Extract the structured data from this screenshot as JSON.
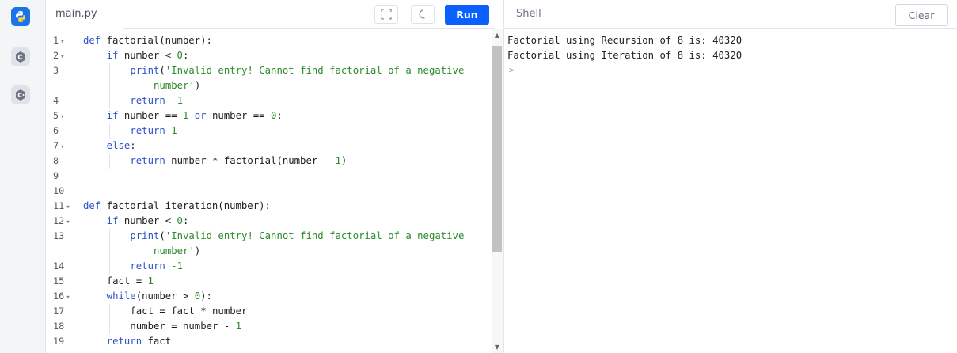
{
  "editor": {
    "tab_label": "main.py",
    "run_label": "Run",
    "lines": [
      {
        "n": "1",
        "fold": "▾",
        "indent": 0,
        "html": "<span class='kw'>def</span> factorial(number):"
      },
      {
        "n": "2",
        "fold": "▾",
        "indent": 1,
        "html": "<span class='kw'>if</span> number &lt; <span class='num'>0</span>:"
      },
      {
        "n": "3",
        "fold": "",
        "indent": 2,
        "html": "<span class='kw'>print</span>(<span class='str'>'Invalid entry! Cannot find factorial of a negative</span>"
      },
      {
        "n": "",
        "fold": "",
        "indent": 3,
        "html": "<span class='str'>number'</span>)"
      },
      {
        "n": "4",
        "fold": "",
        "indent": 2,
        "html": "<span class='kw'>return</span> <span class='num'>-1</span>"
      },
      {
        "n": "5",
        "fold": "▾",
        "indent": 1,
        "html": "<span class='kw'>if</span> number == <span class='num'>1</span> <span class='kw'>or</span> number == <span class='num'>0</span>:"
      },
      {
        "n": "6",
        "fold": "",
        "indent": 2,
        "html": "<span class='kw'>return</span> <span class='num'>1</span>"
      },
      {
        "n": "7",
        "fold": "▾",
        "indent": 1,
        "html": "<span class='kw'>else</span>:"
      },
      {
        "n": "8",
        "fold": "",
        "indent": 2,
        "html": "<span class='kw'>return</span> number * factorial(number - <span class='num'>1</span>)"
      },
      {
        "n": "9",
        "fold": "",
        "indent": 0,
        "html": ""
      },
      {
        "n": "10",
        "fold": "",
        "indent": 0,
        "html": ""
      },
      {
        "n": "11",
        "fold": "▾",
        "indent": 0,
        "html": "<span class='kw'>def</span> factorial_iteration(number):"
      },
      {
        "n": "12",
        "fold": "▾",
        "indent": 1,
        "html": "<span class='kw'>if</span> number &lt; <span class='num'>0</span>:"
      },
      {
        "n": "13",
        "fold": "",
        "indent": 2,
        "html": "<span class='kw'>print</span>(<span class='str'>'Invalid entry! Cannot find factorial of a negative</span>"
      },
      {
        "n": "",
        "fold": "",
        "indent": 3,
        "html": "<span class='str'>number'</span>)"
      },
      {
        "n": "14",
        "fold": "",
        "indent": 2,
        "html": "<span class='kw'>return</span> <span class='num'>-1</span>"
      },
      {
        "n": "15",
        "fold": "",
        "indent": 1,
        "html": "fact = <span class='num'>1</span>"
      },
      {
        "n": "16",
        "fold": "▾",
        "indent": 1,
        "html": "<span class='kw'>while</span>(number &gt; <span class='num'>0</span>):"
      },
      {
        "n": "17",
        "fold": "",
        "indent": 2,
        "html": "fact = fact * number"
      },
      {
        "n": "18",
        "fold": "",
        "indent": 2,
        "html": "number = number - <span class='num'>1</span>"
      },
      {
        "n": "19",
        "fold": "",
        "indent": 1,
        "html": "<span class='kw'>return</span> fact"
      }
    ]
  },
  "shell": {
    "title": "Shell",
    "clear_label": "Clear",
    "output": [
      "Factorial using Recursion of 8 is: 40320",
      "Factorial using Iteration of 8 is: 40320"
    ],
    "prompt": ">"
  },
  "colors": {
    "accent": "#0b61ff",
    "keyword": "#2c52c9",
    "string": "#2b8a2b"
  },
  "icons": [
    "python-icon",
    "c-language-icon",
    "cpp-language-icon",
    "fullscreen-icon",
    "dark-mode-icon"
  ]
}
